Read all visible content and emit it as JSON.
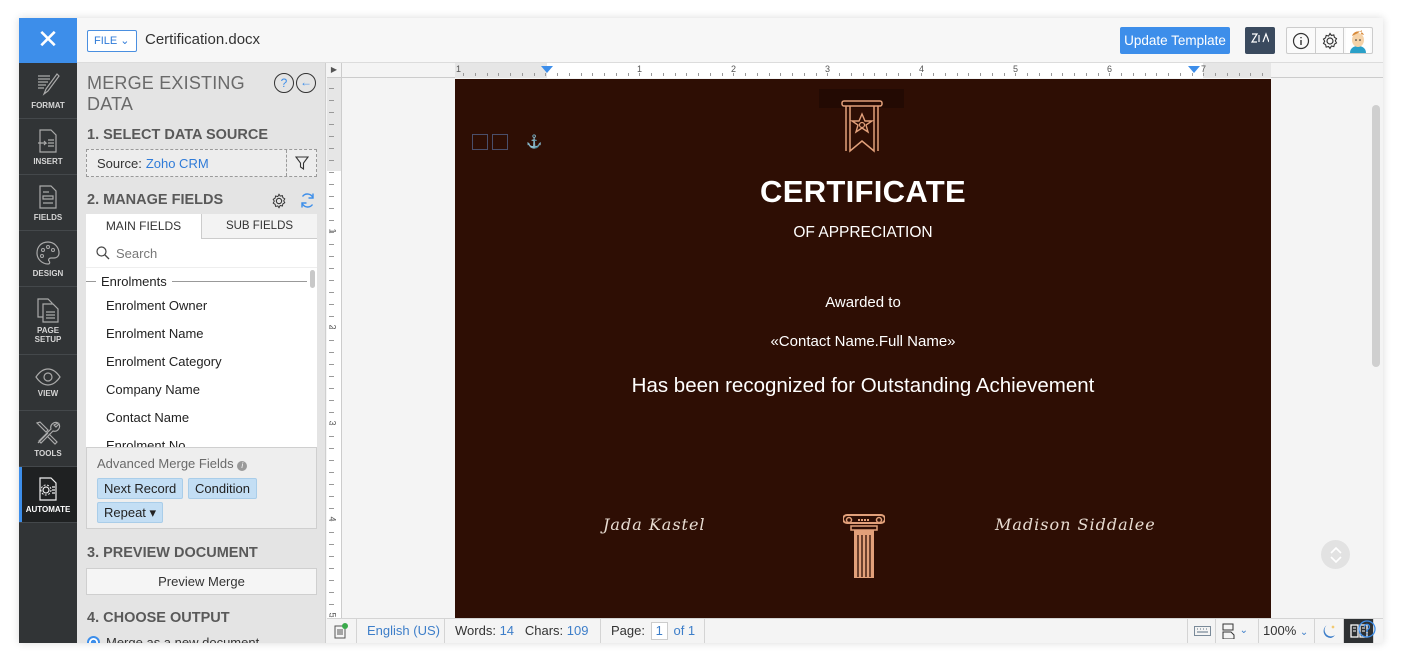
{
  "topbar": {
    "close_icon": "close-icon",
    "file_label": "FILE",
    "doc_title": "Certification.docx",
    "update_template_label": "Update Template",
    "zia_label": "Zia",
    "icons": [
      "info-icon",
      "gear-icon",
      "avatar"
    ]
  },
  "leftnav": {
    "items": [
      {
        "label": "FORMAT",
        "icon": "format-brush-icon"
      },
      {
        "label": "INSERT",
        "icon": "insert-icon"
      },
      {
        "label": "FIELDS",
        "icon": "fields-icon"
      },
      {
        "label": "DESIGN",
        "icon": "palette-icon"
      },
      {
        "label": "PAGE",
        "label2": "SETUP",
        "icon": "page-setup-icon"
      },
      {
        "label": "VIEW",
        "icon": "eye-icon"
      },
      {
        "label": "TOOLS",
        "icon": "tools-icon"
      },
      {
        "label": "AUTOMATE",
        "icon": "automate-icon",
        "active": true
      }
    ]
  },
  "panel": {
    "title": "MERGE EXISTING DATA",
    "step1": "1. SELECT DATA SOURCE",
    "source_label": "Source:",
    "source_value": "Zoho CRM",
    "step2": "2. MANAGE FIELDS",
    "tabs": [
      {
        "label": "MAIN FIELDS",
        "active": true
      },
      {
        "label": "SUB FIELDS",
        "active": false
      }
    ],
    "search_placeholder": "Search",
    "group": "Enrolments",
    "fields": [
      "Enrolment Owner",
      "Enrolment Name",
      "Enrolment Category",
      "Company Name",
      "Contact Name",
      "Enrolment No"
    ],
    "advanced_title": "Advanced Merge Fields",
    "advanced_chips": [
      "Next Record",
      "Condition",
      "Repeat ▾"
    ],
    "step3": "3. PREVIEW DOCUMENT",
    "preview_button": "Preview Merge",
    "step4": "4. CHOOSE OUTPUT",
    "output_option": "Merge as a new document"
  },
  "ruler": {
    "h_labels": [
      "1",
      "1",
      "2",
      "3",
      "4",
      "5",
      "6",
      "7"
    ],
    "v_labels": [
      "1",
      "2",
      "3",
      "4",
      "5"
    ]
  },
  "document": {
    "title": "CERTIFICATE",
    "subtitle": "OF APPRECIATION",
    "awarded": "Awarded to",
    "merge_field": "«Contact Name.Full Name»",
    "recognized": "Has been recognized for Outstanding Achievement",
    "signature_left": "Jada Kastel",
    "signature_right": "Madison Siddalee",
    "background_color": "#2e0e04",
    "accent_color": "#e2a07a"
  },
  "statusbar": {
    "language": "English (US)",
    "words_label": "Words:",
    "words": "14",
    "chars_label": "Chars:",
    "chars": "109",
    "page_label": "Page:",
    "page_current": "1",
    "page_total": "of 1",
    "zoom": "100%"
  }
}
